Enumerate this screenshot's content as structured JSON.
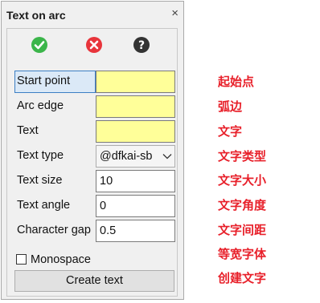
{
  "window": {
    "title": "Text on arc",
    "close_glyph": "×"
  },
  "toolbar": {
    "ok_icon": "check-circle-icon",
    "ok_color": "#3bb54a",
    "cancel_icon": "x-circle-icon",
    "cancel_color": "#e8343b",
    "help_icon": "question-circle-icon",
    "help_color": "#333333"
  },
  "form": {
    "start_point": {
      "label": "Start point",
      "value": ""
    },
    "arc_edge": {
      "label": "Arc edge",
      "value": ""
    },
    "text": {
      "label": "Text",
      "value": ""
    },
    "text_type": {
      "label": "Text type",
      "value": "@dfkai-sb"
    },
    "text_size": {
      "label": "Text size",
      "value": "10"
    },
    "text_angle": {
      "label": "Text angle",
      "value": "0"
    },
    "character_gap": {
      "label": "Character gap",
      "value": "0.5"
    },
    "monospace": {
      "label": "Monospace",
      "checked": false
    },
    "create_label": "Create text",
    "pick_field_color": "#ffff99"
  },
  "annotations": [
    "起始点",
    "弧边",
    "文字",
    "文字类型",
    "文字大小",
    "文字角度",
    "文字间距",
    "等宽字体",
    "创建文字"
  ],
  "annotation_color": "#e8202a"
}
